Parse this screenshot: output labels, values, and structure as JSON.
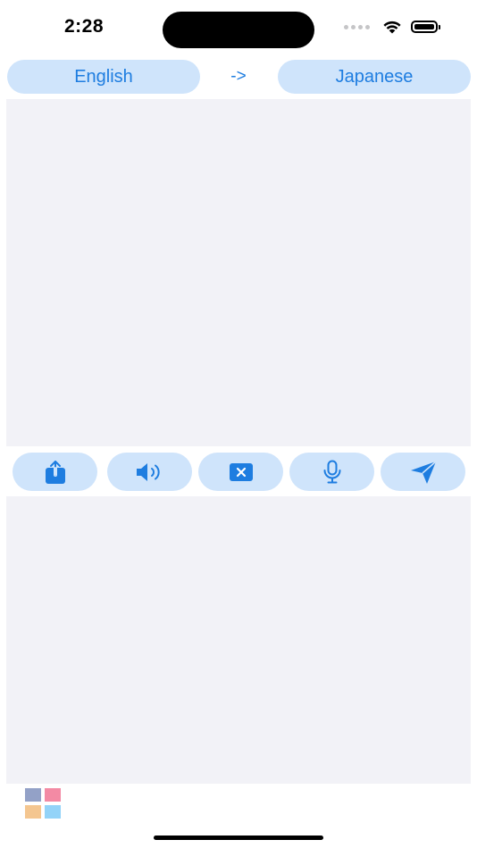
{
  "status_bar": {
    "time": "2:28"
  },
  "language_bar": {
    "source_language": "English",
    "arrow": "->",
    "target_language": "Japanese"
  },
  "input_panel": {
    "text": ""
  },
  "output_panel": {
    "text": ""
  },
  "actions": [
    {
      "icon": "share-icon"
    },
    {
      "icon": "speaker-icon"
    },
    {
      "icon": "clear-icon"
    },
    {
      "icon": "microphone-icon"
    },
    {
      "icon": "send-icon"
    }
  ],
  "colors": {
    "accent": "#1e7de0",
    "button_background": "#cfe4fb",
    "panel_background": "#f2f2f7",
    "logo_tiles": [
      "#93a1c7",
      "#f38aa4",
      "#f4c690",
      "#93d3f8"
    ]
  }
}
